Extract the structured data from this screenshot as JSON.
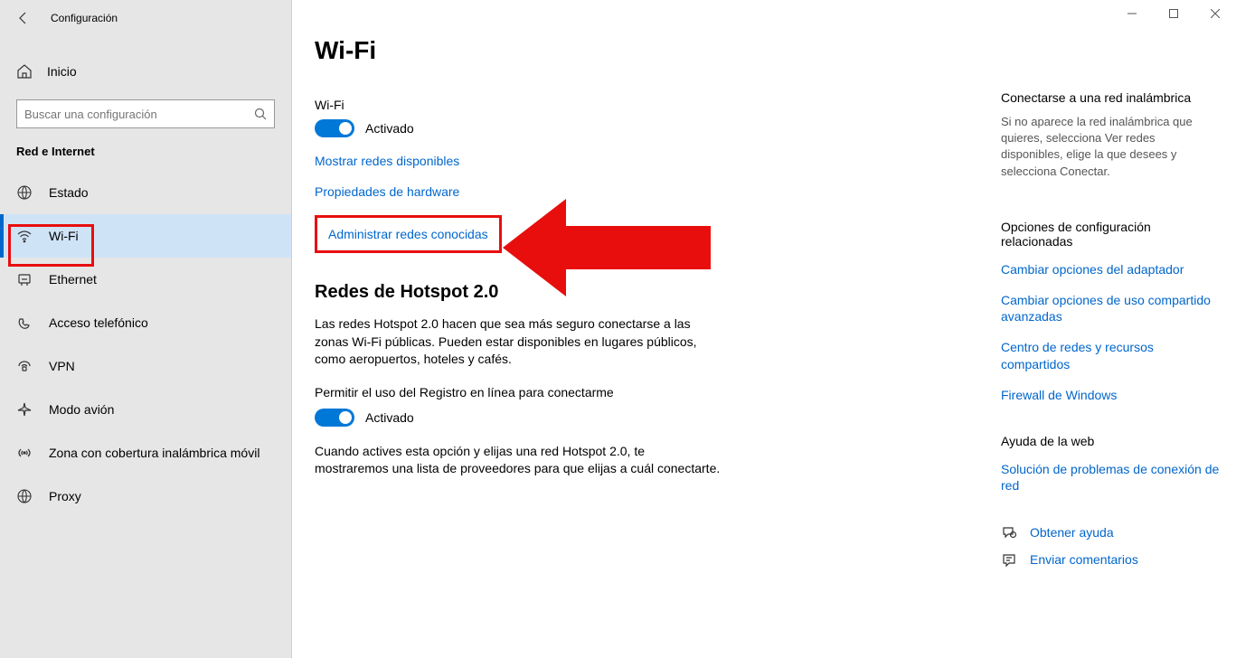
{
  "window": {
    "title": "Configuración"
  },
  "sidebar": {
    "home": "Inicio",
    "search_placeholder": "Buscar una configuración",
    "section": "Red e Internet",
    "items": [
      {
        "label": "Estado"
      },
      {
        "label": "Wi-Fi"
      },
      {
        "label": "Ethernet"
      },
      {
        "label": "Acceso telefónico"
      },
      {
        "label": "VPN"
      },
      {
        "label": "Modo avión"
      },
      {
        "label": "Zona con cobertura inalámbrica móvil"
      },
      {
        "label": "Proxy"
      }
    ]
  },
  "main": {
    "title": "Wi-Fi",
    "wifi_label": "Wi-Fi",
    "wifi_state": "Activado",
    "link_show_networks": "Mostrar redes disponibles",
    "link_hw_props": "Propiedades de hardware",
    "link_manage_known": "Administrar redes conocidas",
    "hotspot_title": "Redes de Hotspot 2.0",
    "hotspot_para": "Las redes Hotspot 2.0 hacen que sea más seguro conectarse a las zonas Wi-Fi públicas. Pueden estar disponibles en lugares públicos, como aeropuertos, hoteles y cafés.",
    "online_reg_label": "Permitir el uso del Registro en línea para conectarme",
    "online_reg_state": "Activado",
    "online_reg_para": "Cuando actives esta opción y elijas una red Hotspot 2.0, te mostraremos una lista de proveedores para que elijas a cuál conectarte."
  },
  "right": {
    "connect_title": "Conectarse a una red inalámbrica",
    "connect_para": "Si no aparece la red inalámbrica que quieres, selecciona Ver redes disponibles, elige la que desees y selecciona Conectar.",
    "related_title": "Opciones de configuración relacionadas",
    "link_adapter": "Cambiar opciones del adaptador",
    "link_sharing": "Cambiar opciones de uso compartido avanzadas",
    "link_netcenter": "Centro de redes y recursos compartidos",
    "link_firewall": "Firewall de Windows",
    "webhelp_title": "Ayuda de la web",
    "link_troubleshoot": "Solución de problemas de conexión de red",
    "get_help": "Obtener ayuda",
    "send_feedback": "Enviar comentarios"
  }
}
